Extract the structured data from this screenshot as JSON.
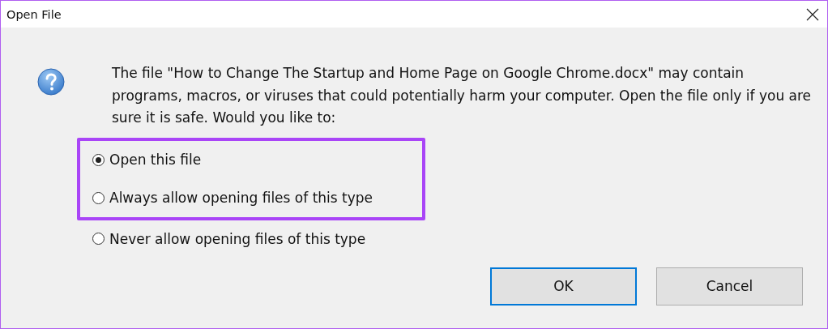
{
  "window": {
    "title": "Open File"
  },
  "message": "The file \"How to Change The Startup and Home Page on Google Chrome.docx\" may contain programs, macros, or viruses that could potentially harm your computer. Open the file only if you are sure it is safe. Would you like to:",
  "options": [
    {
      "label": "Open this file",
      "selected": true,
      "highlighted": true
    },
    {
      "label": "Always allow opening files of this type",
      "selected": false,
      "highlighted": true
    },
    {
      "label": "Never allow opening files of this type",
      "selected": false,
      "highlighted": false
    }
  ],
  "buttons": [
    {
      "label": "OK",
      "default": true
    },
    {
      "label": "Cancel",
      "default": false
    }
  ]
}
